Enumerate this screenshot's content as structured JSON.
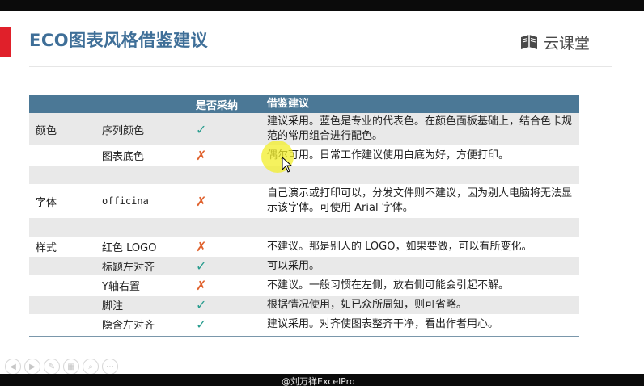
{
  "slide": {
    "title": "ECO图表风格借鉴建议",
    "brand": "云课堂"
  },
  "table": {
    "headers": [
      "",
      "",
      "是否采纳",
      "借鉴建议"
    ],
    "rows": [
      {
        "category": "颜色",
        "item": "序列颜色",
        "adopt": "✓",
        "advice": "建议采用。蓝色是专业的代表色。在颜色面板基础上，结合色卡规范的常用组合进行配色。"
      },
      {
        "category": "",
        "item": "图表底色",
        "adopt": "✗",
        "advice": "偶尔可用。日常工作建议使用白底为好，方便打印。"
      },
      {
        "category": "",
        "item": "",
        "adopt": "",
        "advice": ""
      },
      {
        "category": "字体",
        "item": "officina",
        "adopt": "✗",
        "advice": "自己演示或打印可以，分发文件则不建议，因为别人电脑将无法显示该字体。可使用 Arial 字体。"
      },
      {
        "category": "",
        "item": "",
        "adopt": "",
        "advice": ""
      },
      {
        "category": "样式",
        "item": "红色 LOGO",
        "adopt": "✗",
        "advice": "不建议。那是别人的 LOGO，如果要做，可以有所变化。"
      },
      {
        "category": "",
        "item": "标题左对齐",
        "adopt": "✓",
        "advice": "可以采用。"
      },
      {
        "category": "",
        "item": "Y轴右置",
        "adopt": "✗",
        "advice": "不建议。一般习惯在左侧，放右侧可能会引起不解。"
      },
      {
        "category": "",
        "item": "脚注",
        "adopt": "✓",
        "advice": "根据情况使用，如已众所周知，则可省略。"
      },
      {
        "category": "",
        "item": "隐含左对齐",
        "adopt": "✓",
        "advice": "建议采用。对齐使图表整齐干净，看出作者用心。"
      }
    ]
  },
  "player": {
    "controls": [
      "prev-icon",
      "next-icon",
      "pen-icon",
      "pages-icon",
      "zoom-icon",
      "more-icon"
    ],
    "watermark": "@刘万祥ExcelPro"
  },
  "colors": {
    "title": "#3f6f98",
    "header": "#4b7896",
    "accent": "#e0202a",
    "check": "#2a9d8f",
    "cross": "#e0622e"
  }
}
